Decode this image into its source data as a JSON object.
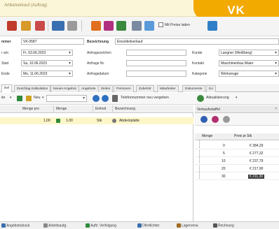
{
  "window": {
    "title": "Artikelverkauf (Auftrag)"
  },
  "badge": {
    "label": "VK"
  },
  "toolbar": {
    "checkbox_label": "Mit Preise laden",
    "checkbox_checked": true
  },
  "header": {
    "row1": {
      "nummer_label": "mmer",
      "nummer_value": "VK-0587",
      "bezeichnung_label": "Bezeichnung",
      "bezeichnung_value": "Einzelteilverkauf"
    },
    "row2": {
      "datum_label": "r am",
      "datum_value": "Fr, 03.06.2023",
      "anfrage_label": "Anfragezeichen",
      "anfrage_value": "",
      "kunde_label": "Kunde",
      "kunde_value": "Langner (Weißberg)"
    },
    "row3": {
      "start_label": "Start",
      "start_value": "Sa, 10.06.2023",
      "anfragenr_label": "Anfrage Nr.",
      "anfragenr_value": "",
      "kontakt_label": "Kontakt",
      "kontakt_value": "Maschinenbau Maier"
    },
    "row4": {
      "ende_label": "Ende",
      "ende_value": "Mo, 11.06.2023",
      "anfragedatum_label": "Anfragedatum",
      "anfragedatum_value": "",
      "kategorie_label": "Kategorie",
      "kategorie_value": "Werkzeuge"
    }
  },
  "tabs": [
    {
      "label": "ikel",
      "active": true
    },
    {
      "label": "Zuschlag Kalkulation",
      "active": false
    },
    {
      "label": "Neues Angebot",
      "active": false
    },
    {
      "label": "Angebote",
      "active": false
    },
    {
      "label": "Zeiten",
      "active": false
    },
    {
      "label": "Personen",
      "active": false
    },
    {
      "label": "Zubehör",
      "active": false
    },
    {
      "label": "Mitarbeiter",
      "active": false
    },
    {
      "label": "Dokumente",
      "active": false
    },
    {
      "label": "Ko",
      "active": false
    }
  ],
  "subbar": {
    "first_label": "ite",
    "neu_label": "Neu",
    "phone_label": "Telefonnummer neu vergeben",
    "refresh_label": "Aktualisierung"
  },
  "grid": {
    "headers": [
      "Menge pro",
      "Menge",
      "Einheit",
      "Bezeichnung"
    ],
    "rows": [
      {
        "menge_pro": "1,00",
        "menge": "1,00",
        "einheit": "Stk",
        "bezeichnung": "Abdeckplatte"
      }
    ]
  },
  "panel": {
    "title": "Verkaufsstaffel",
    "close": "×",
    "headers": [
      "Menge",
      "Preis je Stk"
    ],
    "rows": [
      {
        "menge": "0",
        "price": "€ 384,29"
      },
      {
        "menge": "5",
        "price": "€ 277,32"
      },
      {
        "menge": "10",
        "price": "€ 237,79"
      },
      {
        "menge": "20",
        "price": "€ 217,90"
      },
      {
        "menge": "30",
        "price": "€ 211,30"
      }
    ],
    "selected_row_index": 4
  },
  "statusbar": {
    "items": [
      {
        "label": "Angebotsdruck",
        "color": "#3a6fb0"
      },
      {
        "label": "Arbeitsaufg.",
        "color": "#888888"
      },
      {
        "label": "Auftr. Verfolgung",
        "color": "#2f8a3a"
      },
      {
        "label": "Ofertlichter",
        "color": "#3a6fb0"
      },
      {
        "label": "Lagerverw.",
        "color": "#a06a20"
      },
      {
        "label": "Rechnung",
        "color": "#555555"
      }
    ]
  },
  "colors": {
    "accent": "#f2a900",
    "row_highlight": "#fdf6c8"
  }
}
